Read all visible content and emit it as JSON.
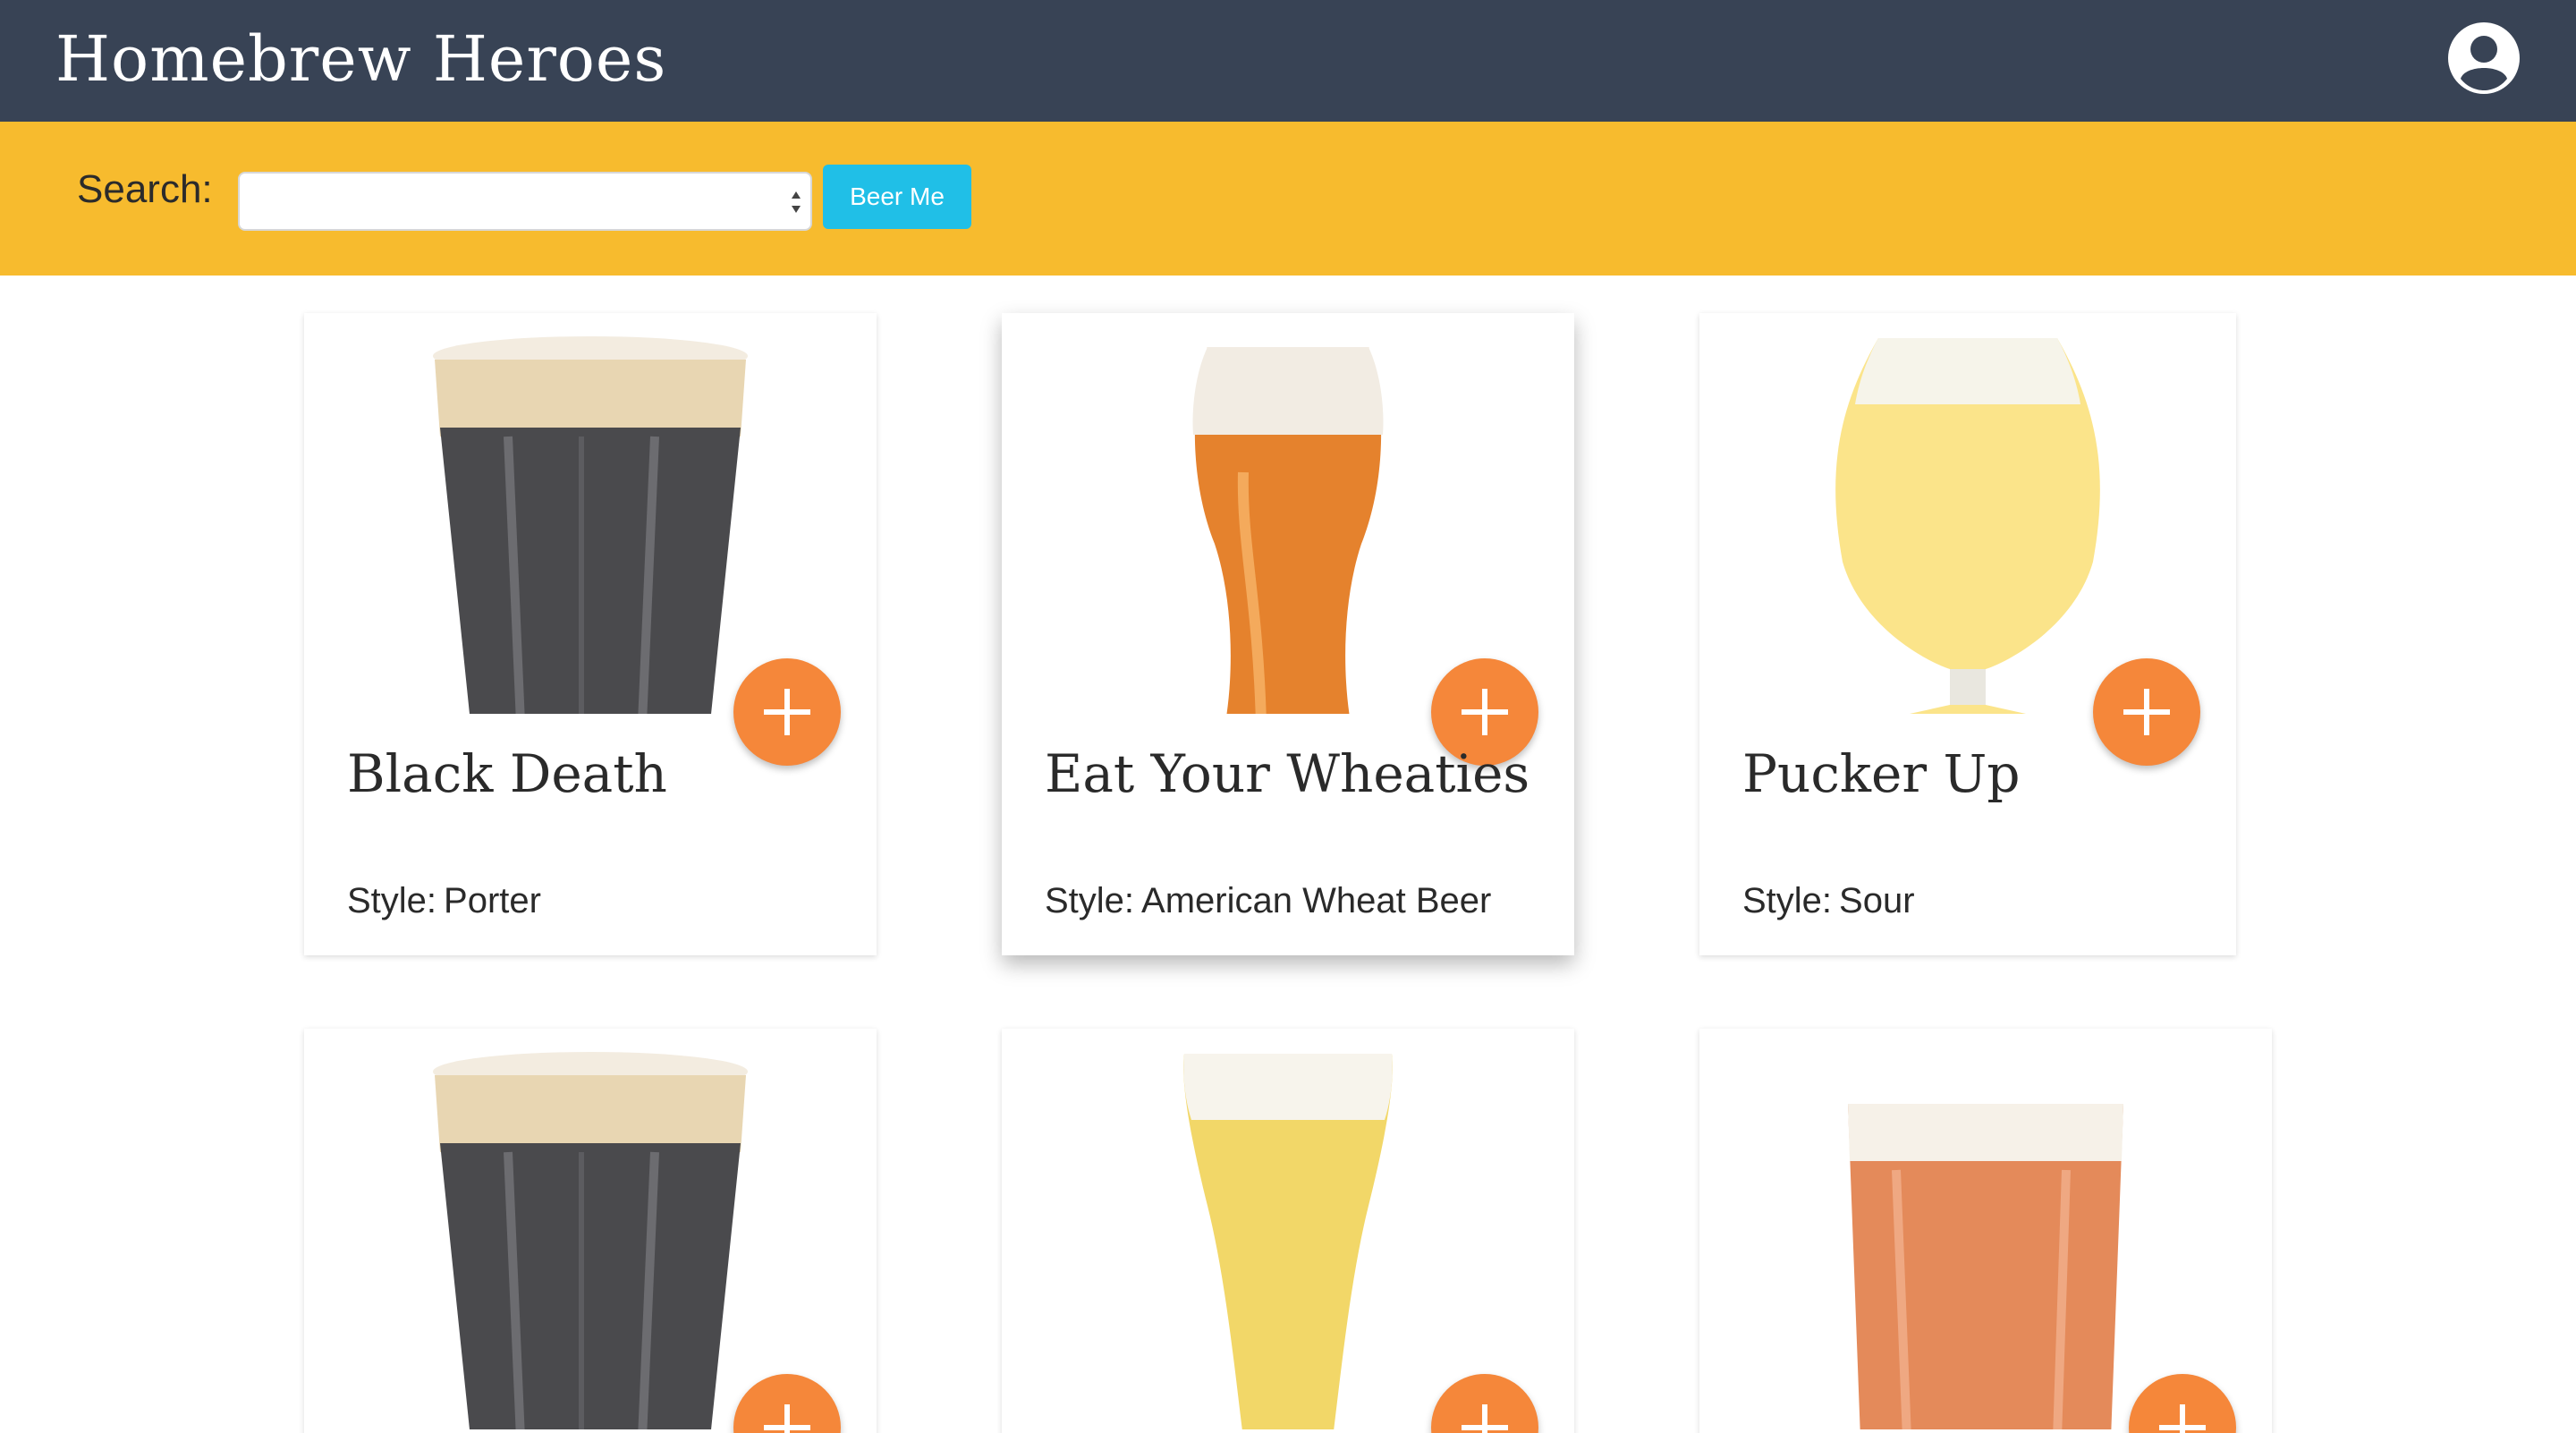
{
  "header": {
    "brand": "Homebrew Heroes",
    "account_icon": "account-circle-icon"
  },
  "search": {
    "label": "Search:",
    "selected": "",
    "button_label": "Beer Me"
  },
  "colors": {
    "topbar": "#384355",
    "searchbar": "#f7bb2e",
    "button": "#20bfe7",
    "fab": "#f5873a"
  },
  "beers": [
    {
      "name": "Black Death",
      "style_label": "Style:",
      "style": "Porter",
      "glass": "stout-pint"
    },
    {
      "name": "Eat Your Wheaties",
      "style_label": "Style:",
      "style": "American Wheat Beer",
      "glass": "wheat-weizen"
    },
    {
      "name": "Pucker Up",
      "style_label": "Style:",
      "style": "Sour",
      "glass": "tulip-sour"
    },
    {
      "name": "",
      "style_label": "",
      "style": "",
      "glass": "stout-pint"
    },
    {
      "name": "",
      "style_label": "",
      "style": "",
      "glass": "pilsner-flute"
    },
    {
      "name": "",
      "style_label": "",
      "style": "",
      "glass": "amber-pint"
    }
  ]
}
